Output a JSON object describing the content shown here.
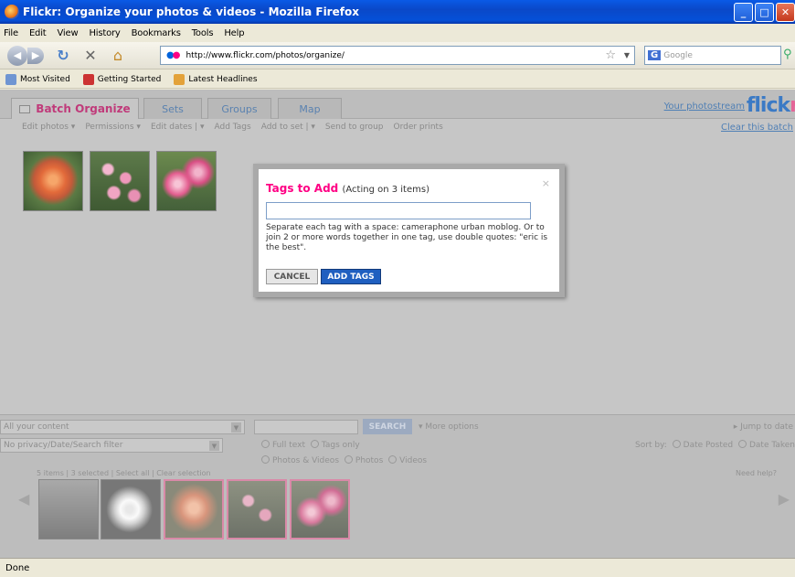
{
  "window": {
    "title": "Flickr: Organize your photos & videos - Mozilla Firefox"
  },
  "menu": [
    "File",
    "Edit",
    "View",
    "History",
    "Bookmarks",
    "Tools",
    "Help"
  ],
  "nav": {
    "url": "http://www.flickr.com/photos/organize/",
    "search_placeholder": "Google"
  },
  "bookmarks": [
    "Most Visited",
    "Getting Started",
    "Latest Headlines"
  ],
  "tabs": [
    "Batch Organize",
    "Sets",
    "Groups",
    "Map"
  ],
  "header": {
    "photostream": "Your photostream",
    "logo_blue": "flick",
    "logo_pink": "r"
  },
  "toolbar": {
    "items": [
      "Edit photos ▾",
      "Permissions ▾",
      "Edit dates | ▾",
      "Add Tags",
      "Add to set | ▾",
      "Send to group",
      "Order prints"
    ],
    "clear_batch": "Clear this batch"
  },
  "modal": {
    "title": "Tags to Add",
    "subtitle": "(Acting on 3 items)",
    "close": "×",
    "input_value": "",
    "help": "Separate each tag with a space: cameraphone urban moblog. Or to join 2 or more words together in one tag, use double quotes: \"eric is the best\".",
    "cancel": "CANCEL",
    "add": "ADD TAGS"
  },
  "filters": {
    "content": "All your content",
    "privacy": "No privacy/Date/Search filter",
    "search_button": "SEARCH",
    "more_options": "▾ More options",
    "jump": "▸ Jump to date",
    "fulltext": "Full text",
    "tagsonly": "Tags only",
    "photosvideos": "Photos & Videos",
    "photos": "Photos",
    "videos": "Videos",
    "sortby": "Sort by:",
    "dateposted": "Date Posted",
    "datetaken": "Date Taken",
    "selection": "5 items | 3 selected | Select all | Clear selection",
    "needhelp": "Need help?"
  },
  "status": "Done",
  "colors": {
    "flickr_blue": "#0063dc",
    "flickr_pink": "#ff0084",
    "xp_title": "#0a48c8"
  }
}
